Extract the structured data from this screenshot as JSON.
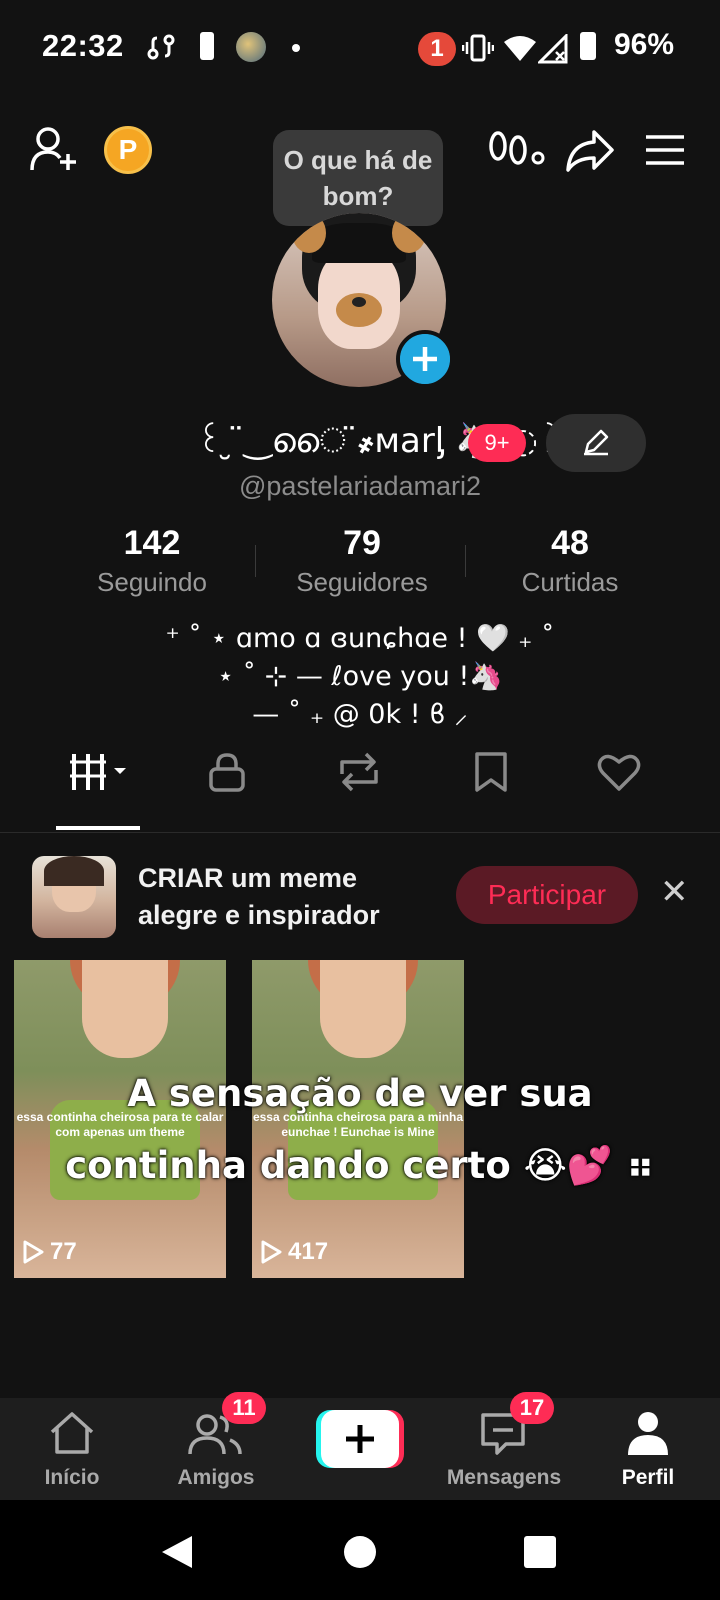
{
  "status_bar": {
    "time": "22:32",
    "notification_count": "1",
    "battery": "96%"
  },
  "header": {
    "tooltip": "O que há de bom?"
  },
  "profile": {
    "display_name": "꒰ ̮ ̈‿ൈ ̈҂ᴍarᶅ 🦄 ◌꒱ ₊ ˙",
    "name_badge": "9+",
    "username": "@pastelariadamari2",
    "stats": [
      {
        "value": "142",
        "label": "Seguindo"
      },
      {
        "value": "79",
        "label": "Seguidores"
      },
      {
        "value": "48",
        "label": "Curtidas"
      }
    ],
    "bio": [
      "⁺ ˚ ⋆ ɑmo ɑ ɞunɕhɑe ! 🤍 ₊ ˚",
      "⋆ ˚ ⊹ — ℓove you !🦄",
      "— ˚ ₊ @ 0k ! ϐ ⸝"
    ]
  },
  "banner": {
    "line1": "CRIAR um meme",
    "line2": "alegre e inspirador",
    "button": "Participar"
  },
  "videos": [
    {
      "views": "77",
      "caption": "essa continha cheirosa para\nte calar com apenas um theme"
    },
    {
      "views": "417",
      "caption": "essa continha cheirosa para a minha eunchae !\nEunchae is Mine"
    }
  ],
  "overlay_caption": {
    "line1": "A sensação de ver sua",
    "line2": "continha dando certo 😭💕 ⠶"
  },
  "bottom_nav": [
    {
      "label": "Início"
    },
    {
      "label": "Amigos",
      "badge": "11"
    },
    {
      "label": ""
    },
    {
      "label": "Mensagens",
      "badge": "17"
    },
    {
      "label": "Perfil"
    }
  ],
  "colors": {
    "accent": "#fe2c55",
    "avatar_add": "#21a8e0"
  }
}
